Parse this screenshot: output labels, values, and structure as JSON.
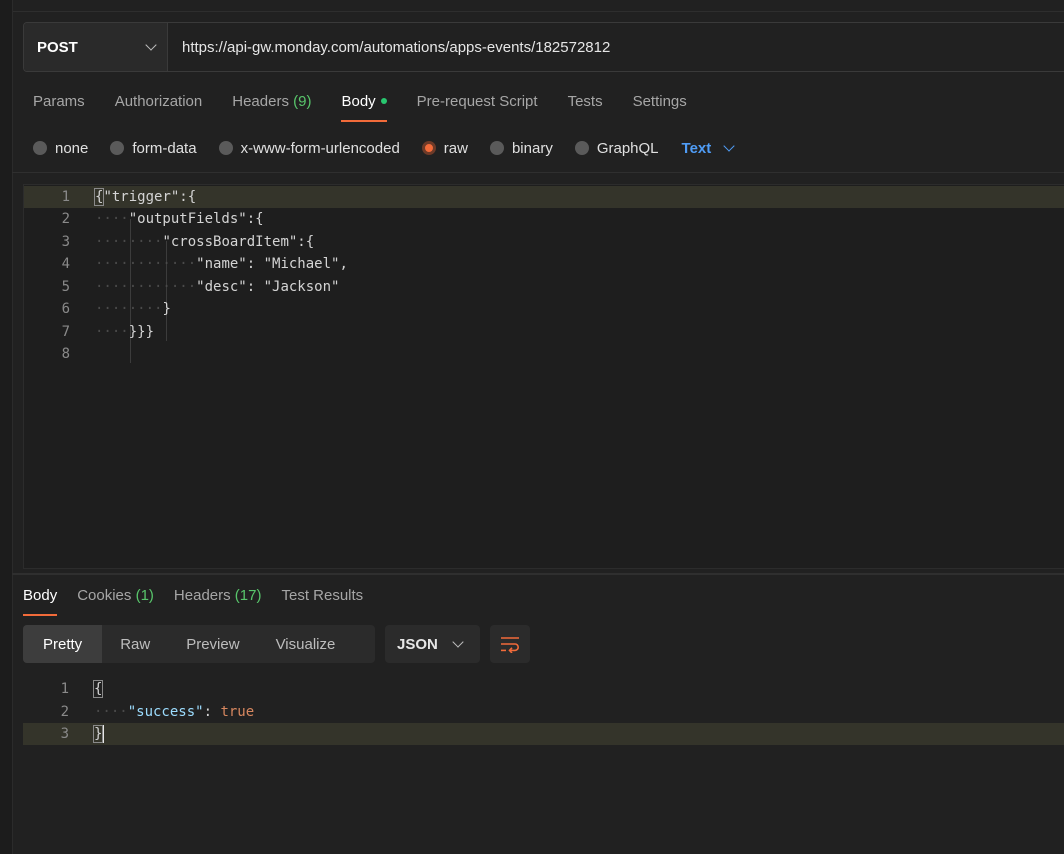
{
  "request": {
    "method": "POST",
    "url": "https://api-gw.monday.com/automations/apps-events/182572812"
  },
  "request_tabs": [
    {
      "label": "Params"
    },
    {
      "label": "Authorization"
    },
    {
      "label": "Headers",
      "count": "(9)"
    },
    {
      "label": "Body",
      "active": true
    },
    {
      "label": "Pre-request Script"
    },
    {
      "label": "Tests"
    },
    {
      "label": "Settings"
    }
  ],
  "body_types": {
    "none": "none",
    "form_data": "form-data",
    "urlencoded": "x-www-form-urlencoded",
    "raw": "raw",
    "binary": "binary",
    "graphql": "GraphQL",
    "selected": "raw",
    "format": "Text"
  },
  "request_body": {
    "line_numbers": [
      "1",
      "2",
      "3",
      "4",
      "5",
      "6",
      "7",
      "8"
    ],
    "lines": [
      "{\"trigger\":{",
      "\"outputFields\":{",
      "\"crossBoardItem\":{",
      "\"name\": \"Michael\",",
      "\"desc\": \"Jackson\"",
      "}",
      "}}}",
      ""
    ]
  },
  "response_tabs": [
    {
      "label": "Body",
      "active": true
    },
    {
      "label": "Cookies",
      "count": "(1)"
    },
    {
      "label": "Headers",
      "count": "(17)"
    },
    {
      "label": "Test Results"
    }
  ],
  "response_view": {
    "modes": [
      "Pretty",
      "Raw",
      "Preview",
      "Visualize"
    ],
    "active": "Pretty",
    "language": "JSON",
    "wrap_icon": "wrap-lines-icon"
  },
  "response_body": {
    "line_numbers": [
      "1",
      "2",
      "3"
    ],
    "open_brace": "{",
    "key": "\"success\"",
    "colon": ": ",
    "value": "true",
    "close_brace": "}"
  },
  "colors": {
    "accent": "#f26b3a",
    "link": "#4f9cf5",
    "count": "#58c56b",
    "dot": "#28c76f"
  }
}
